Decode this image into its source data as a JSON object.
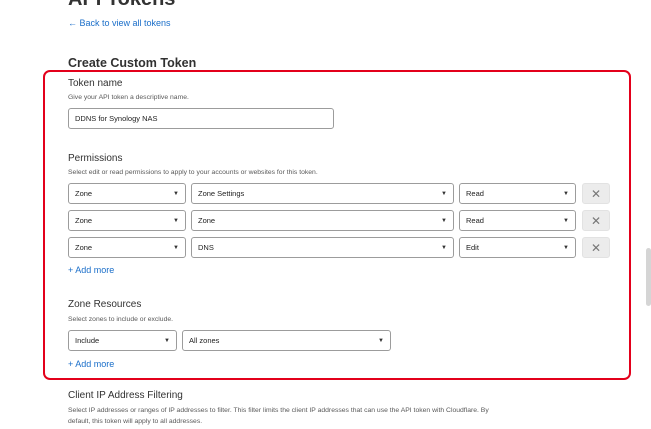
{
  "page": {
    "title": "API Tokens",
    "back_link": "← Back to view all tokens",
    "section_title": "Create Custom Token"
  },
  "token_name": {
    "label": "Token name",
    "help": "Give your API token a descriptive name.",
    "value": "DDNS for Synology NAS"
  },
  "permissions": {
    "label": "Permissions",
    "help": "Select edit or read permissions to apply to your accounts or websites for this token.",
    "rows": [
      {
        "scope": "Zone",
        "resource": "Zone Settings",
        "access": "Read"
      },
      {
        "scope": "Zone",
        "resource": "Zone",
        "access": "Read"
      },
      {
        "scope": "Zone",
        "resource": "DNS",
        "access": "Edit"
      }
    ],
    "add_more": "+ Add more"
  },
  "zone_resources": {
    "label": "Zone Resources",
    "help": "Select zones to include or exclude.",
    "mode": "Include",
    "zones": "All zones",
    "add_more": "+ Add more"
  },
  "client_ip": {
    "label": "Client IP Address Filtering",
    "help_line1": "Select IP addresses or ranges of IP addresses to filter. This filter limits the client IP addresses that can use the API token with Cloudflare. By",
    "help_line2": "default, this token will apply to all addresses."
  },
  "colors": {
    "highlight": "#e3001b",
    "link": "#1a6ec9"
  },
  "icons": {
    "caret": "caret-down-icon",
    "remove": "close-icon"
  }
}
